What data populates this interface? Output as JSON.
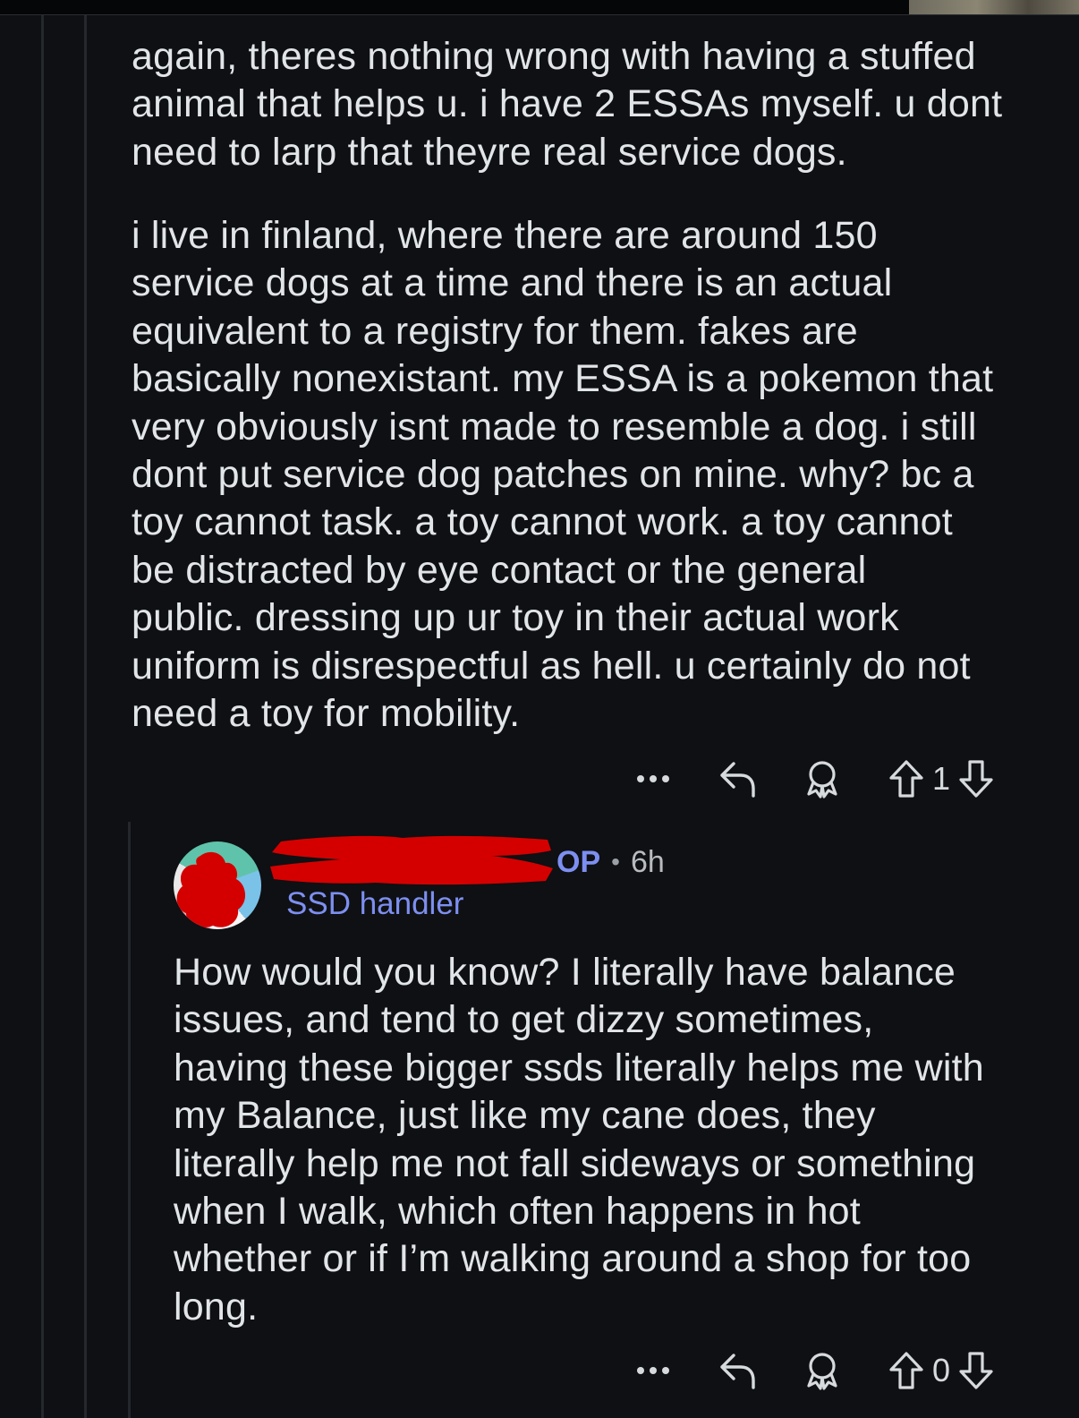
{
  "parent_comment": {
    "paragraphs": [
      "again, theres nothing wrong with having a stuffed\nanimal that helps u. i have 2 ESSAs myself. u dont\nneed to larp that theyre real service dogs.",
      "i live in finland, where there are around 150\nservice dogs at a time and there is an actual\nequivalent to a registry for them. fakes are\nbasically nonexistant. my ESSA is a pokemon that\nvery obviously isnt made to resemble a dog. i still\ndont put service dog patches on mine. why? bc a\ntoy cannot task. a toy cannot work. a toy cannot\nbe distracted by eye contact or the general\npublic. dressing up ur toy in their actual work\nuniform is disrespectful as hell. u certainly do not\nneed a toy for mobility."
    ],
    "vote_count": "1"
  },
  "reply": {
    "badge": "OP",
    "separator": "•",
    "time": "6h",
    "flair": "SSD handler",
    "body": "How would you know? I literally have balance\nissues, and tend to get dizzy sometimes,\nhaving these bigger ssds literally helps me with\nmy Balance, just like my cane does, they\nliterally help me not  fall sideways or something\nwhen I walk, which often happens in hot\nwhether or if I’m walking around a shop for too\nlong.",
    "vote_count": "0"
  },
  "icons": {
    "more": "more-options-icon",
    "reply": "reply-icon",
    "award": "award-icon",
    "upvote": "upvote-icon",
    "downvote": "downvote-icon"
  },
  "colors": {
    "background": "#0e1013",
    "text": "#e2e5e8",
    "accent": "#7d8ff0",
    "redaction": "#d40000"
  }
}
